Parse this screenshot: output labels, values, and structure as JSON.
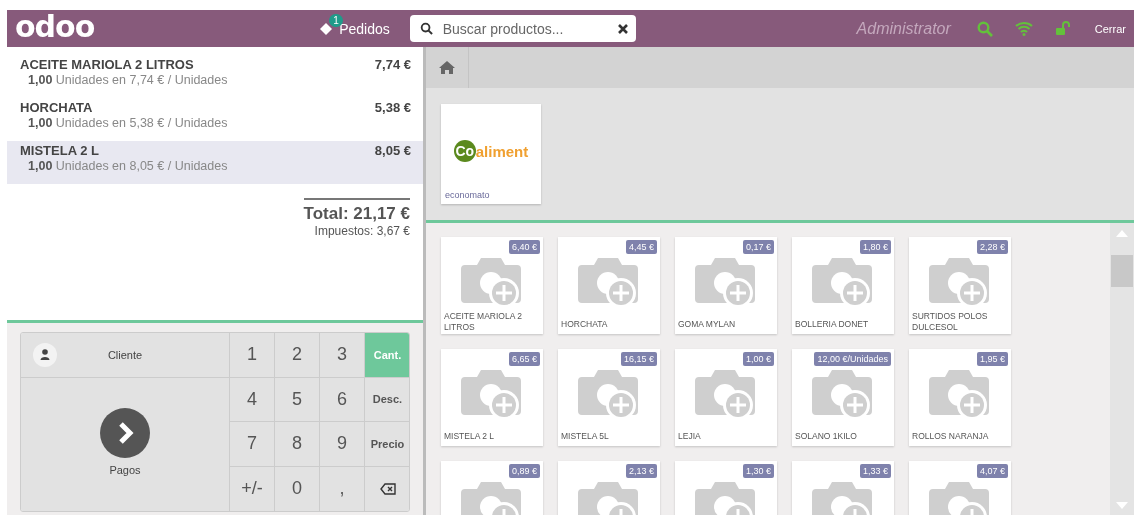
{
  "header": {
    "logo": "odoo",
    "orders": {
      "badge": "1",
      "label": "Pedidos"
    },
    "search": {
      "placeholder": "Buscar productos..."
    },
    "user": "Administrator",
    "close": "Cerrar"
  },
  "order_lines": [
    {
      "name": "ACEITE MARIOLA 2 LITROS",
      "price": "7,74 €",
      "qty": "1,00",
      "detail": "Unidades en 7,74 € / Unidades",
      "selected": false
    },
    {
      "name": "HORCHATA",
      "price": "5,38 €",
      "qty": "1,00",
      "detail": "Unidades en 5,38 € / Unidades",
      "selected": false
    },
    {
      "name": "MISTELA 2 L",
      "price": "8,05 €",
      "qty": "1,00",
      "detail": "Unidades en 8,05 € / Unidades",
      "selected": true
    }
  ],
  "summary": {
    "total": "Total: 21,17 €",
    "taxes": "Impuestos: 3,67 €"
  },
  "actions": {
    "customer": "Cliente",
    "payment": "Pagos"
  },
  "keypad": [
    {
      "kind": "digit",
      "label": "1"
    },
    {
      "kind": "digit",
      "label": "2"
    },
    {
      "kind": "digit",
      "label": "3"
    },
    {
      "kind": "mode",
      "label": "Cant.",
      "selected": true
    },
    {
      "kind": "digit",
      "label": "4"
    },
    {
      "kind": "digit",
      "label": "5"
    },
    {
      "kind": "digit",
      "label": "6"
    },
    {
      "kind": "mode",
      "label": "Desc.",
      "selected": false
    },
    {
      "kind": "digit",
      "label": "7"
    },
    {
      "kind": "digit",
      "label": "8"
    },
    {
      "kind": "digit",
      "label": "9"
    },
    {
      "kind": "mode",
      "label": "Precio",
      "selected": false
    },
    {
      "kind": "digit",
      "label": "+/-"
    },
    {
      "kind": "digit",
      "label": "0"
    },
    {
      "kind": "digit",
      "label": ","
    },
    {
      "kind": "backspace"
    }
  ],
  "categories": [
    {
      "logo_mark": "Co",
      "logo_text": "aliment",
      "label": "economato"
    }
  ],
  "products": [
    {
      "price": "6,40 €",
      "name": "ACEITE MARIOLA 2 LITROS"
    },
    {
      "price": "4,45 €",
      "name": "HORCHATA"
    },
    {
      "price": "0,17 €",
      "name": "GOMA MYLAN"
    },
    {
      "price": "1,80 €",
      "name": "BOLLERIA DONET"
    },
    {
      "price": "2,28 €",
      "name": "SURTIDOS POLOS DULCESOL"
    },
    {
      "price": "6,65 €",
      "name": "MISTELA 2 L"
    },
    {
      "price": "16,15 €",
      "name": "MISTELA 5L"
    },
    {
      "price": "1,00 €",
      "name": "LEJIA"
    },
    {
      "price": "12,00 €/Unidades",
      "name": "SOLANO 1KILO"
    },
    {
      "price": "1,95 €",
      "name": "ROLLOS NARANJA"
    },
    {
      "price": "0,89 €"
    },
    {
      "price": "2,13 €"
    },
    {
      "price": "1,30 €"
    },
    {
      "price": "1,33 €"
    },
    {
      "price": "4,07 €"
    }
  ]
}
